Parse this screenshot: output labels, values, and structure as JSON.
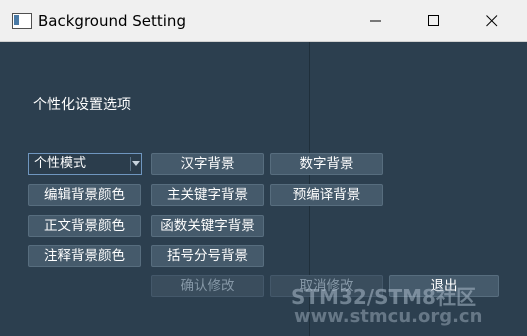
{
  "window": {
    "title": "Background Setting"
  },
  "main": {
    "heading": "个性化设置选项",
    "mode_select": {
      "value": "个性模式"
    },
    "buttons": {
      "hanzi_bg": "汉字背景",
      "number_bg": "数字背景",
      "editor_bg_color": "编辑背景颜色",
      "main_keyword_bg": "主关键字背景",
      "precompile_bg": "预编译背景",
      "body_bg_color": "正文背景颜色",
      "func_keyword_bg": "函数关键字背景",
      "comment_bg_color": "注释背景颜色",
      "bracket_bg": "括号分号背景",
      "confirm": "确认修改",
      "cancel": "取消修改",
      "exit": "退出"
    }
  },
  "watermark": {
    "line1": "STM32/STM8社区",
    "line2": "www.stmcu.org.cn"
  },
  "colors": {
    "client_bg": "#2c3f4f",
    "button_bg": "#455a6b",
    "select_border": "#6f96bf"
  }
}
